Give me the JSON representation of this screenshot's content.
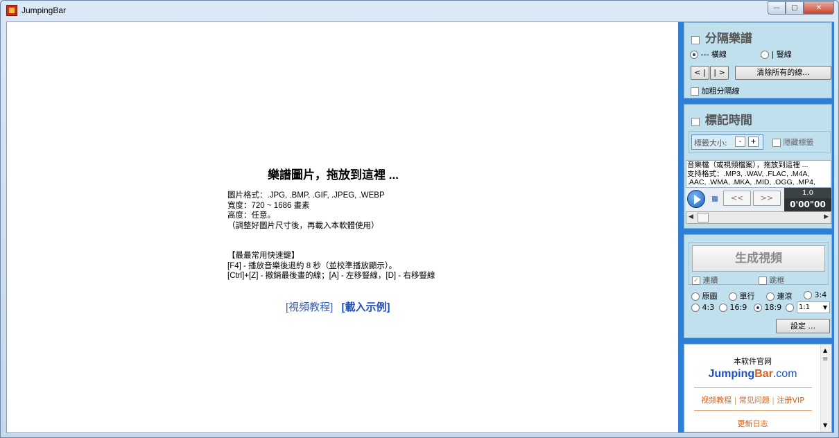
{
  "window": {
    "title": "JumpingBar"
  },
  "window_controls": {
    "minimize": "—",
    "maximize": "□",
    "close": "✕"
  },
  "main": {
    "drop_title": "樂譜圖片，拖放到這裡 ...",
    "info_lines": [
      "圖片格式：.JPG, .BMP, .GIF, .JPEG, .WEBP",
      "寬度：720 ~ 1686 畫素",
      "高度：任意。",
      "（調整好圖片尺寸後，再載入本軟體使用）",
      "",
      "",
      "【最最常用快速鍵】",
      "[F4] - 播放音樂後退約 8 秒（並校準播放顯示）。",
      "[Ctrl]+[Z] - 撤銷最後畫的線；[A] - 左移豎線，[D] - 右移豎線"
    ],
    "link_tutorial": "[視頻教程]",
    "link_example": "[載入示例]"
  },
  "separator": {
    "title": "分隔樂譜",
    "radio_horizontal": "--- 橫線",
    "radio_vertical": "| 豎線",
    "horizontal_selected": true,
    "btn_prev": "< |",
    "btn_next": "| >",
    "btn_clear": "清除所有的線...",
    "bold_label": "加粗分隔線"
  },
  "marker": {
    "title": "標記時間",
    "tag_size_label": "標籤大小:",
    "minus": "-",
    "plus": "+",
    "hide_label": "隱藏標籤",
    "media_lines": [
      "音樂檔（或視頻檔案），拖放到這裡 ...",
      "支持格式：.MP3, .WAV, .FLAC, .M4A,",
      ".AAC, .WMA, .MKA, .MID, .OGG, .MP4,"
    ],
    "rewind": "<<",
    "forward": ">>",
    "speed": "1.0",
    "time": "0'00\"00"
  },
  "generate": {
    "button": "生成視頻",
    "continuous": "連續",
    "skip": "跳框",
    "modes": [
      "原圖",
      "單行",
      "連滾",
      "3:4"
    ],
    "ratios": [
      "4:3",
      "16:9",
      "18:9"
    ],
    "selected_ratio": "18:9",
    "select_value": "1:1",
    "settings": "設定 ..."
  },
  "website": {
    "label": "本软件官网",
    "brand_a": "Jumping",
    "brand_b": "Bar",
    "brand_c": ".com",
    "link1": "视频教程",
    "sep": "|",
    "link2": "常见问题",
    "link3": "注册VIP",
    "changelog": "更新日志"
  },
  "colors": {
    "accent": "#2f7fd6",
    "panel": "#c0e0ee",
    "link": "#1b4fc9",
    "orange": "#d4601a"
  }
}
